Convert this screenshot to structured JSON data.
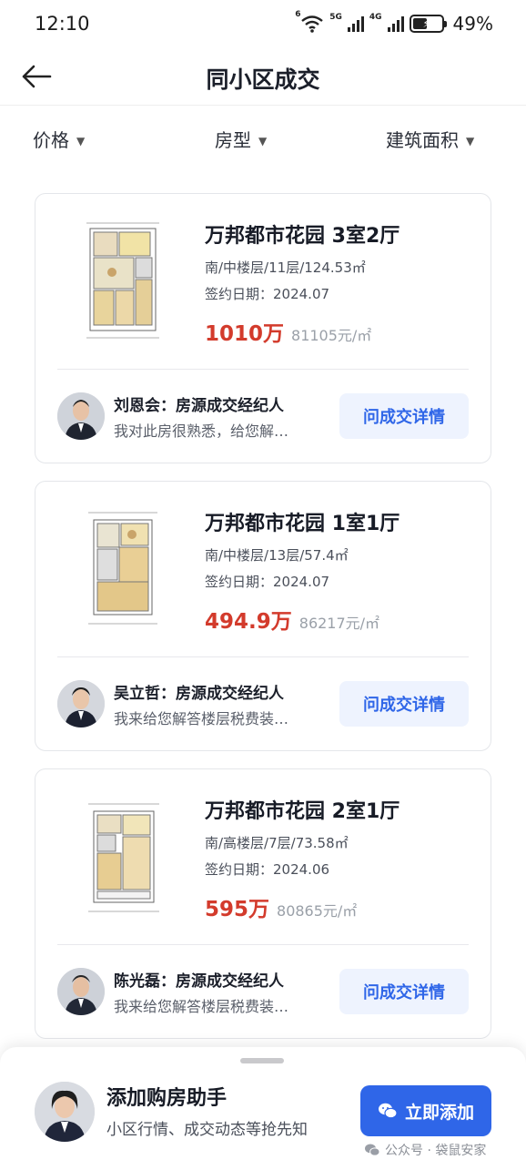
{
  "status_bar": {
    "time": "12:10",
    "wifi_label": "6",
    "sim1_label": "5G",
    "sim2_label": "4G",
    "battery_percent": "49%",
    "battery_level": 0.49,
    "icons": [
      "wifi-icon",
      "signal-5g-icon",
      "signal-4g-icon",
      "battery-charging-icon"
    ]
  },
  "header": {
    "back_icon": "arrow-left-icon",
    "title": "同小区成交"
  },
  "filters": [
    {
      "label": "价格",
      "icon": "chevron-down-icon"
    },
    {
      "label": "房型",
      "icon": "chevron-down-icon"
    },
    {
      "label": "建筑面积",
      "icon": "chevron-down-icon"
    }
  ],
  "listings": [
    {
      "title": "万邦都市花园 3室2厅",
      "meta": "南/中楼层/11层/124.53㎡",
      "date": "签约日期：2024.07",
      "price": "1010万",
      "unit_price": "81105元/㎡",
      "agent_name": "刘恩会：房源成交经纪人",
      "agent_message": "我对此房很熟悉，给您解…",
      "button": "问成交详情"
    },
    {
      "title": "万邦都市花园 1室1厅",
      "meta": "南/中楼层/13层/57.4㎡",
      "date": "签约日期：2024.07",
      "price": "494.9万",
      "unit_price": "86217元/㎡",
      "agent_name": "吴立哲：房源成交经纪人",
      "agent_message": "我来给您解答楼层税费装…",
      "button": "问成交详情"
    },
    {
      "title": "万邦都市花园 2室1厅",
      "meta": "南/高楼层/7层/73.58㎡",
      "date": "签约日期：2024.06",
      "price": "595万",
      "unit_price": "80865元/㎡",
      "agent_name": "陈光磊：房源成交经纪人",
      "agent_message": "我来给您解答楼层税费装…",
      "button": "问成交详情"
    }
  ],
  "assistant": {
    "title": "添加购房助手",
    "subtitle": "小区行情、成交动态等抢先知",
    "button": "立即添加",
    "button_icon": "wechat-icon"
  },
  "watermark": {
    "text": "公众号 · 袋鼠安家",
    "icon": "wechat-icon"
  },
  "colors": {
    "price": "#d33b2c",
    "accent": "#2f66e8",
    "button_bg": "#eef3fe"
  }
}
